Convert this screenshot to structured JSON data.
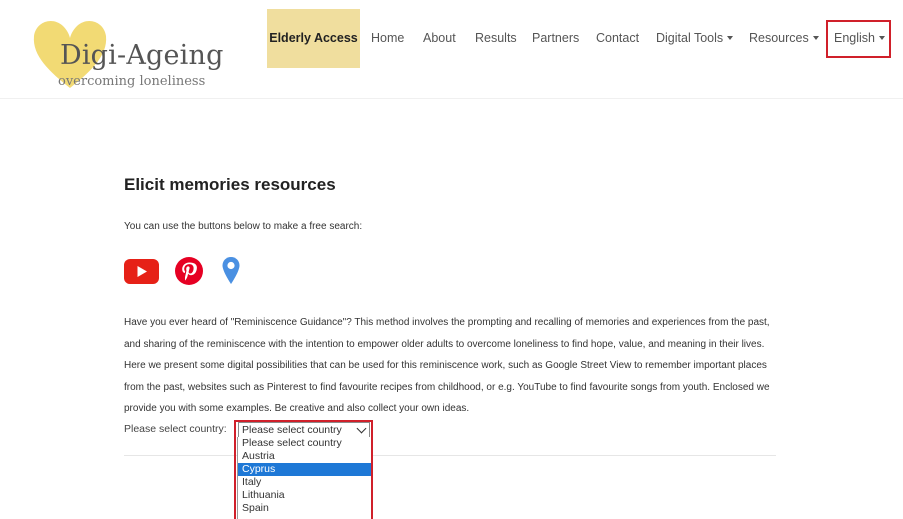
{
  "logo": {
    "title": "Digi-Ageing",
    "subtitle": "overcoming loneliness",
    "heart_color": "#f0d35c"
  },
  "nav": {
    "elderly_access": "Elderly Access",
    "home": "Home",
    "about": "About",
    "results": "Results",
    "partners": "Partners",
    "contact": "Contact",
    "digital_tools": "Digital Tools",
    "resources": "Resources",
    "language": "English"
  },
  "main": {
    "title": "Elicit memories resources",
    "intro": "You can use the buttons below to make a free search:",
    "social": {
      "youtube": "youtube-icon",
      "pinterest": "pinterest-icon",
      "maps": "map-pin-icon"
    },
    "paragraph": "Have you ever heard of \"Reminiscence Guidance\"? This method involves the prompting and recalling of memories and experiences from the past, and sharing of the reminiscence with the intention to empower older adults to overcome loneliness to find hope, value, and meaning in their lives. Here we present some digital possibilities that can be used for this reminiscence work, such as Google Street View to remember important places from the past, websites such as Pinterest to find favourite recipes from childhood, or e.g. YouTube to find favourite songs from youth. Enclosed we provide you with some examples. Be creative and also collect your own ideas.",
    "country_label": "Please select country:",
    "select_value": "Please select country",
    "options": [
      "Please select country",
      "Austria",
      "Cyprus",
      "Italy",
      "Lithuania",
      "Spain"
    ]
  },
  "colors": {
    "accent_nav": "#f0de9e",
    "highlight_box": "#d0202a",
    "option_selected": "#1e78d6",
    "youtube": "#e62117",
    "pinterest": "#e60023",
    "maps": "#4a90e2"
  }
}
